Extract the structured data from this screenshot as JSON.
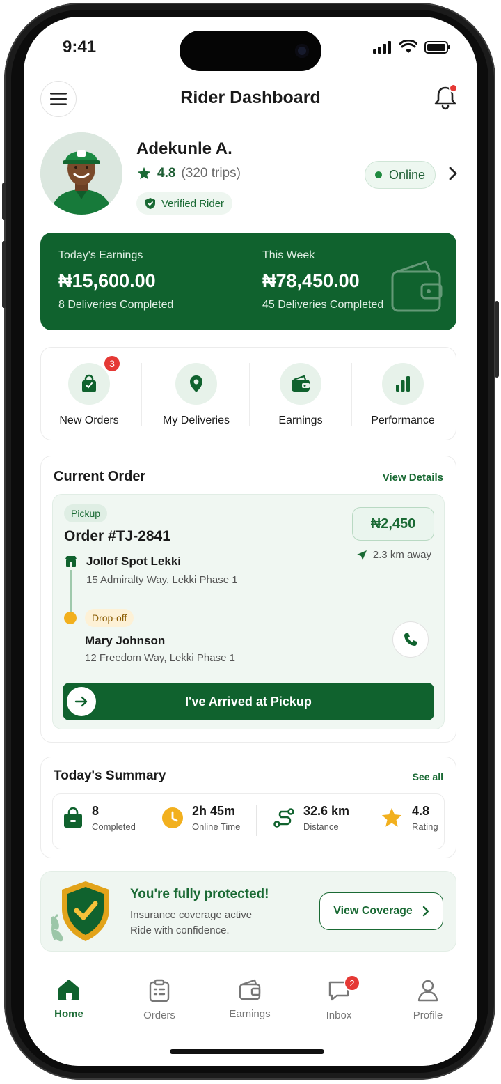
{
  "status_bar": {
    "time": "9:41"
  },
  "header": {
    "title": "Rider Dashboard"
  },
  "profile": {
    "name": "Adekunle A.",
    "rating": "4.8",
    "trips": "(320 trips)",
    "verified_label": "Verified Rider",
    "status": "Online"
  },
  "earnings": {
    "today_label": "Today's Earnings",
    "today_amount": "₦15,600.00",
    "today_sub": "8 Deliveries Completed",
    "week_label": "This Week",
    "week_amount": "₦78,450.00",
    "week_sub": "45 Deliveries Completed"
  },
  "quick_actions": [
    {
      "label": "New Orders",
      "icon": "shopping-bag-icon",
      "badge": "3"
    },
    {
      "label": "My Deliveries",
      "icon": "location-pin-icon"
    },
    {
      "label": "Earnings",
      "icon": "wallet-icon"
    },
    {
      "label": "Performance",
      "icon": "bar-chart-icon"
    }
  ],
  "current_order": {
    "title": "Current Order",
    "link": "View Details",
    "pickup_tag": "Pickup",
    "order_id": "Order #TJ-2841",
    "price": "₦2,450",
    "distance": "2.3 km away",
    "pickup_name": "Jollof Spot Lekki",
    "pickup_address": "15 Admiralty Way, Lekki Phase 1",
    "dropoff_tag": "Drop-off",
    "dropoff_name": "Mary Johnson",
    "dropoff_address": "12 Freedom Way, Lekki Phase 1",
    "action_label": "I've Arrived at Pickup"
  },
  "summary": {
    "title": "Today's Summary",
    "link": "See all",
    "items": [
      {
        "value": "8",
        "label": "Completed",
        "icon": "bag-icon"
      },
      {
        "value": "2h 45m",
        "label": "Online Time",
        "icon": "clock-icon"
      },
      {
        "value": "32.6 km",
        "label": "Distance",
        "icon": "route-icon"
      },
      {
        "value": "4.8",
        "label": "Rating",
        "icon": "star-icon"
      }
    ]
  },
  "protection": {
    "title": "You're fully protected!",
    "line1": "Insurance coverage active",
    "line2": "Ride with confidence.",
    "button": "View Coverage"
  },
  "tabs": [
    {
      "label": "Home",
      "icon": "home-icon",
      "active": true
    },
    {
      "label": "Orders",
      "icon": "clipboard-icon"
    },
    {
      "label": "Earnings",
      "icon": "wallet-icon"
    },
    {
      "label": "Inbox",
      "icon": "chat-icon",
      "badge": "2"
    },
    {
      "label": "Profile",
      "icon": "user-icon"
    }
  ],
  "colors": {
    "brand_green": "#10622e",
    "accent_yellow": "#f2b01e",
    "alert_red": "#e53935"
  }
}
